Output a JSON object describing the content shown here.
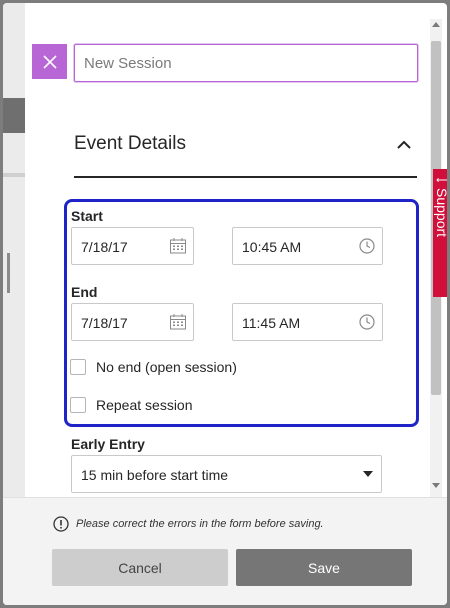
{
  "panel": {
    "title_placeholder": "New Session",
    "section_title": "Event Details"
  },
  "start": {
    "label": "Start",
    "date": "7/18/17",
    "time": "10:45 AM"
  },
  "end": {
    "label": "End",
    "date": "7/18/17",
    "time": "11:45 AM"
  },
  "options": {
    "no_end": {
      "label": "No end (open session)",
      "checked": false
    },
    "repeat": {
      "label": "Repeat session",
      "checked": false
    }
  },
  "early_entry": {
    "label": "Early Entry",
    "selected": "15 min before start time"
  },
  "footer": {
    "error_message": "Please correct the errors in the form before saving.",
    "cancel_label": "Cancel",
    "save_label": "Save"
  },
  "support_tab": {
    "label": "Support"
  },
  "icons": {
    "close": "close-icon",
    "collapse": "chevron-up-icon",
    "calendar": "calendar-icon",
    "clock": "clock-icon",
    "dropdown": "caret-down-icon",
    "error": "exclamation-circle-icon"
  },
  "colors": {
    "accent_purple": "#b865d6",
    "highlight_blue": "#1f24c8",
    "support_red": "#d10f3b",
    "save_button": "#767676",
    "cancel_button": "#cdcdcd"
  }
}
